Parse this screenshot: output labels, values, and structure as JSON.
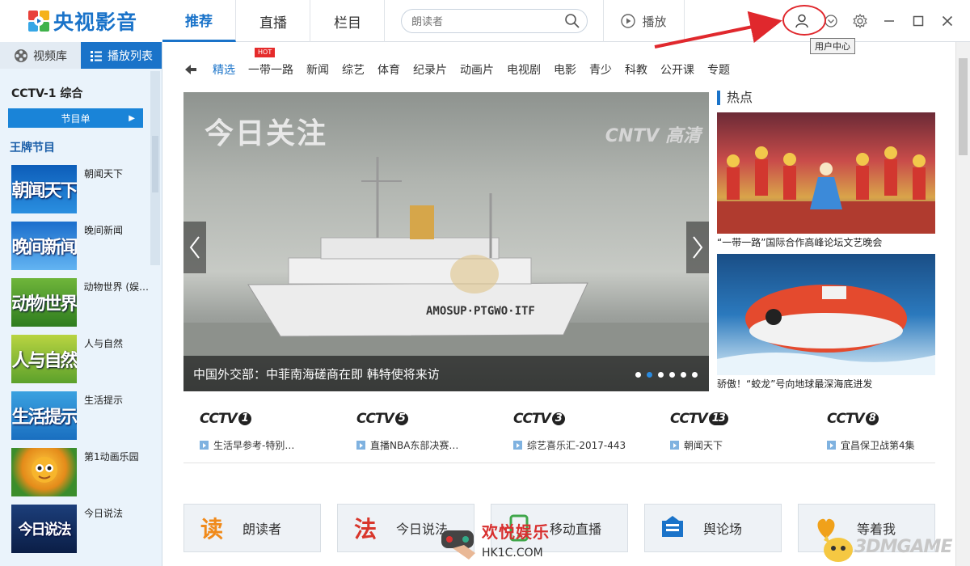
{
  "app": {
    "logo_text": "央视影音",
    "brand_color": "#1a73c9"
  },
  "topnav": {
    "tabs": [
      "推荐",
      "直播",
      "栏目"
    ],
    "search_placeholder": "朗读者",
    "play_label": "播放",
    "tooltip": "用户中心"
  },
  "sidebar": {
    "tab_library": "视频库",
    "tab_playlist": "播放列表",
    "channel": "CCTV-1 综合",
    "program_guide": "节目单",
    "section_title": "王牌节目",
    "programs": [
      {
        "name": "朝闻天下",
        "thumb_text": "朝闻天下"
      },
      {
        "name": "晚间新闻",
        "thumb_text": "晚间新闻"
      },
      {
        "name": "动物世界 (娱…",
        "thumb_text": "动物世界"
      },
      {
        "name": "人与自然",
        "thumb_text": "人与自然"
      },
      {
        "name": "生活提示",
        "thumb_text": "生活提示"
      },
      {
        "name": "第1动画乐园",
        "thumb_text": ""
      },
      {
        "name": "今日说法",
        "thumb_text": "今日说法"
      }
    ]
  },
  "categories": {
    "hot_badge": "HOT",
    "items": [
      "精选",
      "一带一路",
      "新闻",
      "综艺",
      "体育",
      "纪录片",
      "动画片",
      "电视剧",
      "电影",
      "青少",
      "科教",
      "公开课",
      "专题"
    ]
  },
  "hero": {
    "title": "今日关注",
    "logo": "CNTV 高清",
    "ship_text": "AMOSUP·PTGWO·ITF",
    "caption": "中国外交部：中菲南海磋商在即 韩特使将来访",
    "slide_count": 6,
    "active_slide": 2
  },
  "hot": {
    "heading": "热点",
    "items": [
      "“一带一路”国际合作高峰论坛文艺晚会",
      "骄傲！“蛟龙”号向地球最深海底进发"
    ]
  },
  "channels": [
    {
      "num": "1",
      "text": "生活早参考-特别…"
    },
    {
      "num": "5",
      "text": "直播NBA东部决赛…"
    },
    {
      "num": "3",
      "text": "综艺喜乐汇-2017-443"
    },
    {
      "num": "13",
      "text": "朝闻天下"
    },
    {
      "num": "8",
      "text": "宜昌保卫战第4集"
    }
  ],
  "channel_brand": "CCTV",
  "cards": [
    {
      "icon": "读",
      "label": "朗读者"
    },
    {
      "icon": "法",
      "label": "今日说法"
    },
    {
      "icon": "",
      "label": "移动直播"
    },
    {
      "icon": "",
      "label": "舆论场"
    },
    {
      "icon": "",
      "label": "等着我"
    }
  ],
  "watermarks": {
    "hk_cn": "欢悦娱乐",
    "hk_url": "HK1C.COM",
    "gm": "3DMGAME"
  }
}
